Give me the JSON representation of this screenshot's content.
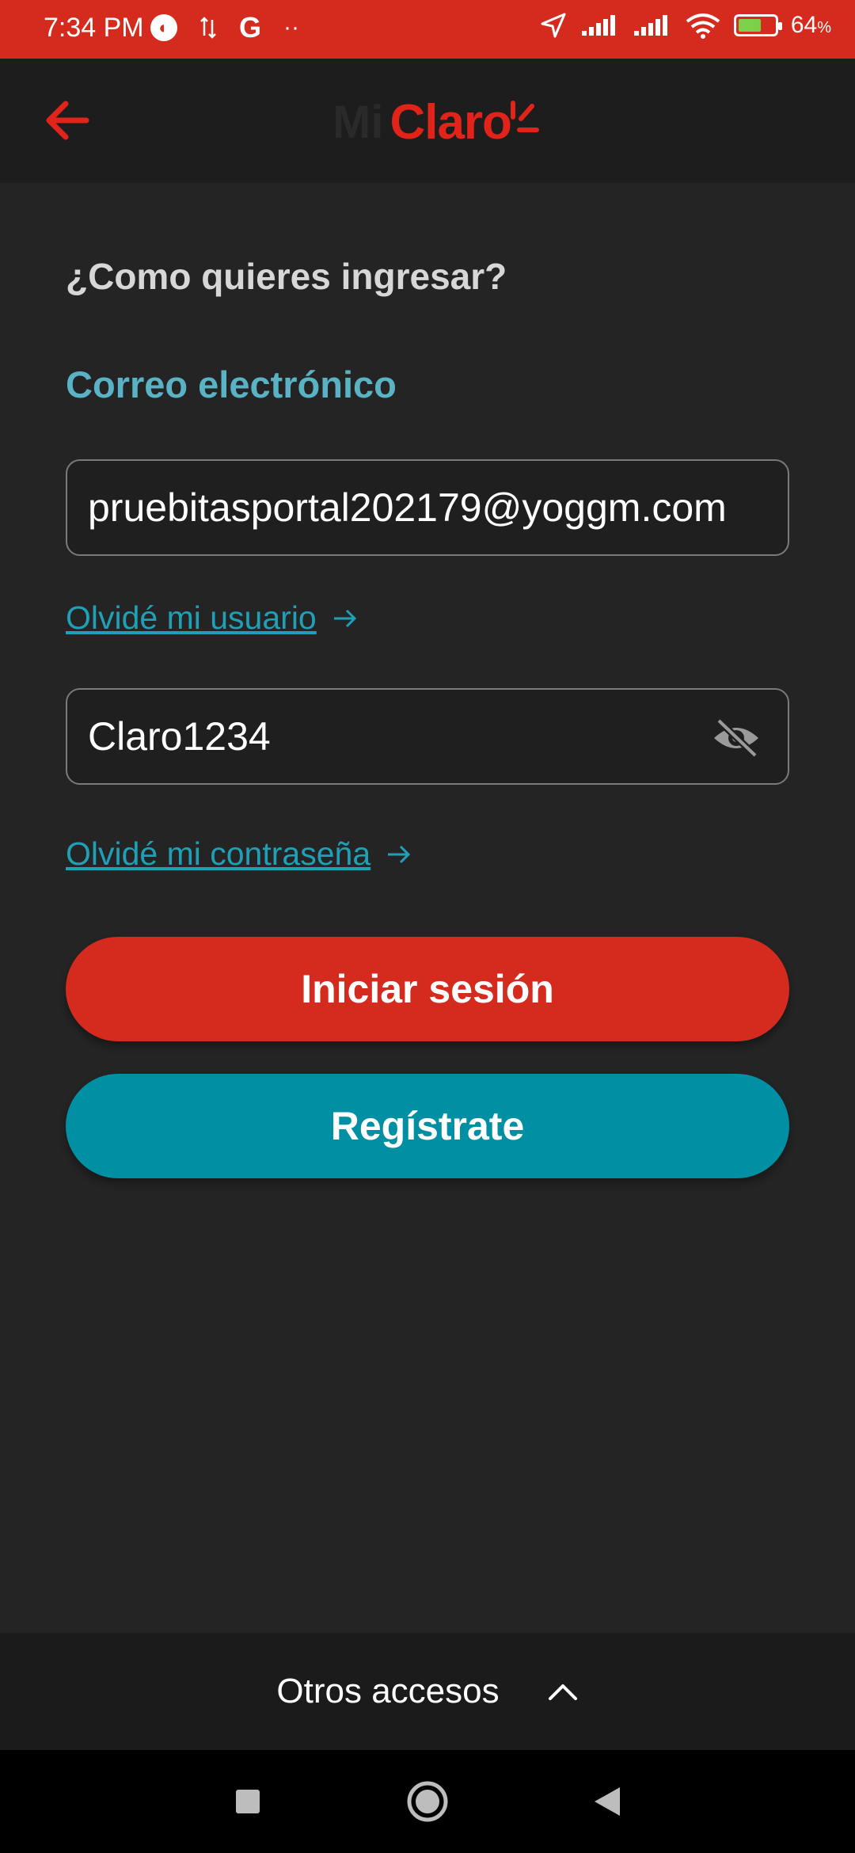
{
  "status_bar": {
    "time": "7:34 PM",
    "battery": "64",
    "battery_unit": "%",
    "battery_level": 0.64,
    "icons": [
      "notification-icon",
      "data-transfer-icon",
      "google-icon",
      "more-dots-icon",
      "location-icon",
      "signal-icon",
      "signal-icon",
      "wifi-icon",
      "battery-icon"
    ]
  },
  "header": {
    "logo_prefix": "Mi",
    "logo_text": "Claro",
    "back_icon": "back-arrow-icon"
  },
  "main": {
    "question": "¿Como quieres ingresar?",
    "method_label": "Correo electrónico",
    "email_value": "pruebitasportal202179@yoggm.com",
    "forgot_user": "Olvidé mi usuario",
    "password_value": "Claro1234",
    "forgot_password": "Olvidé mi contraseña",
    "login_button": "Iniciar sesión",
    "register_button": "Regístrate"
  },
  "bottom": {
    "other_access": "Otros accesos"
  },
  "colors": {
    "brand_red": "#d52b1e",
    "teal_button": "#008fa3",
    "link_teal": "#1fa0b6",
    "label_teal": "#5ab3c4",
    "background": "#242424"
  }
}
